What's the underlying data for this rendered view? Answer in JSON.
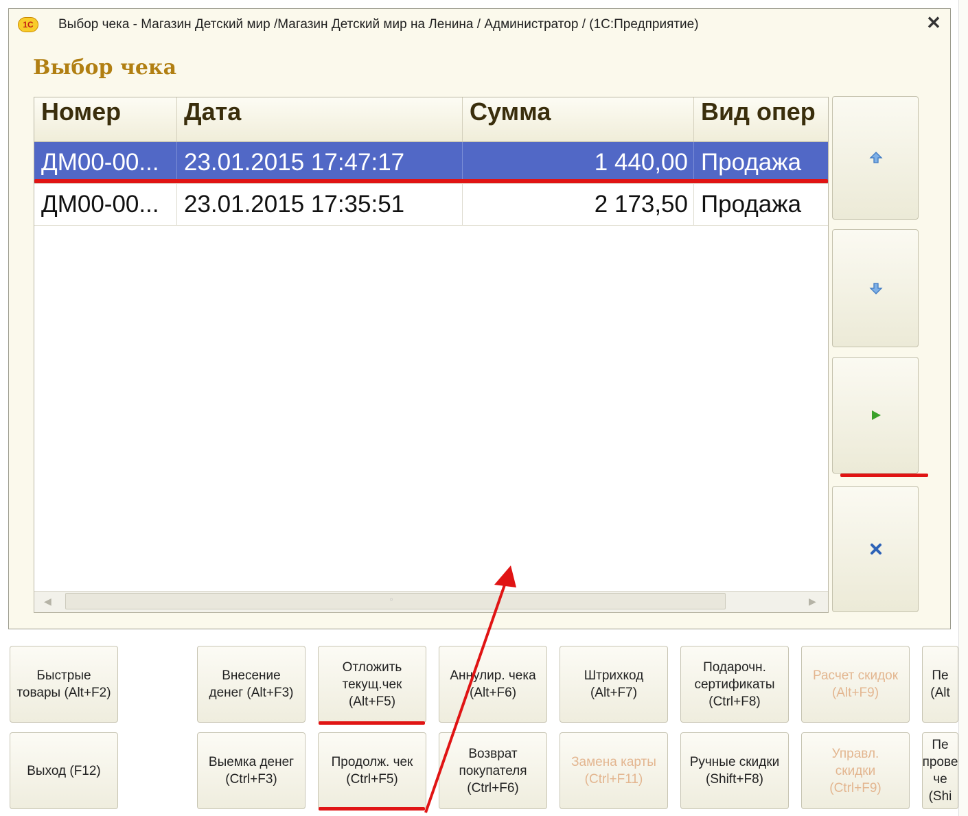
{
  "window": {
    "title": "Выбор чека - Магазин Детский мир /Магазин Детский мир на Ленина / Администратор /  (1С:Предприятие)",
    "logo": "1С",
    "close_label": "✕"
  },
  "form_title": "Выбор чека",
  "table": {
    "columns": [
      "Номер",
      "Дата",
      "Сумма",
      "Вид опер"
    ],
    "rows": [
      {
        "number": "ДМ00-00...",
        "date": "23.01.2015 17:47:17",
        "sum": "1 440,00",
        "type": "Продажа",
        "selected": true
      },
      {
        "number": "ДМ00-00...",
        "date": "23.01.2015 17:35:51",
        "sum": "2 173,50",
        "type": "Продажа",
        "selected": false
      }
    ]
  },
  "side_buttons": [
    "arrow-up-icon",
    "arrow-down-icon",
    "play-icon",
    "cancel-icon"
  ],
  "bottom_buttons": {
    "row1": [
      {
        "label": "Быстрые\nтовары (Alt+F2)",
        "disabled": false
      },
      {
        "label": "Внесение\nденег (Alt+F3)",
        "disabled": false
      },
      {
        "label": "Отложить\nтекущ.чек\n(Alt+F5)",
        "disabled": false
      },
      {
        "label": "Аннулир. чека\n(Alt+F6)",
        "disabled": false
      },
      {
        "label": "Штрихкод\n(Alt+F7)",
        "disabled": false
      },
      {
        "label": "Подарочн.\nсертификаты\n(Ctrl+F8)",
        "disabled": false
      },
      {
        "label": "Расчет скидок\n(Alt+F9)",
        "disabled": true
      },
      {
        "label": "Пе\n(Alt",
        "disabled": false
      }
    ],
    "row2": [
      {
        "label": "Выход (F12)",
        "disabled": false
      },
      {
        "label": "Выемка денег\n(Ctrl+F3)",
        "disabled": false
      },
      {
        "label": "Продолж. чек\n(Ctrl+F5)",
        "disabled": false
      },
      {
        "label": "Возврат\nпокупателя\n(Ctrl+F6)",
        "disabled": false
      },
      {
        "label": "Замена карты\n(Ctrl+F11)",
        "disabled": true
      },
      {
        "label": "Ручные скидки\n(Shift+F8)",
        "disabled": false
      },
      {
        "label": "Управл.\nскидки\n(Ctrl+F9)",
        "disabled": true
      },
      {
        "label": "Пе\nпрове\nче\n(Shi",
        "disabled": false
      }
    ]
  },
  "colors": {
    "selection": "#5168c6",
    "title": "#b17f12",
    "annotation": "#e01414",
    "disabled_text": "#e3b690"
  }
}
